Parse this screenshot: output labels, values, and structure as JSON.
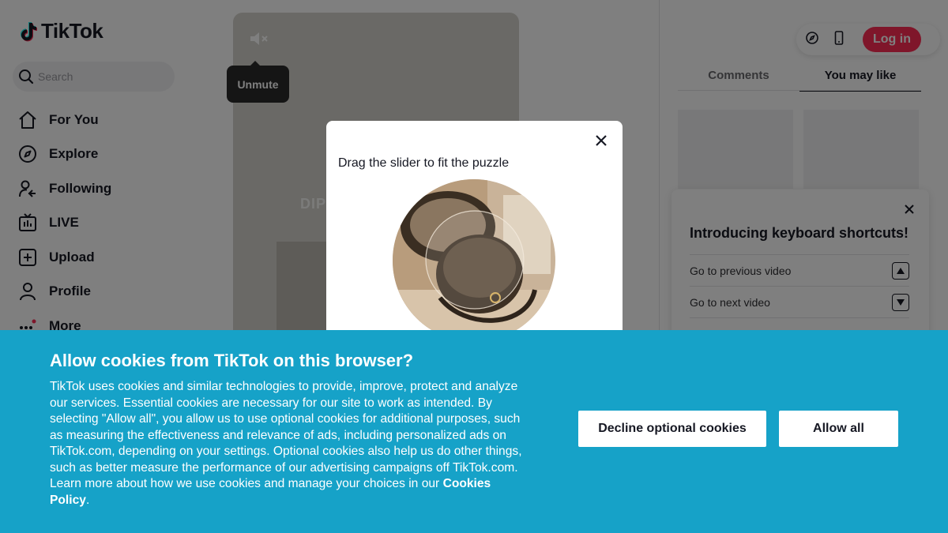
{
  "app": {
    "logo_text": "TikTok",
    "brand_color": "#fe2c55"
  },
  "search": {
    "placeholder": "Search"
  },
  "sidebar": {
    "items": [
      {
        "label": "For You",
        "icon": "home-icon"
      },
      {
        "label": "Explore",
        "icon": "compass-icon"
      },
      {
        "label": "Following",
        "icon": "following-icon"
      },
      {
        "label": "LIVE",
        "icon": "live-icon"
      },
      {
        "label": "Upload",
        "icon": "upload-icon"
      },
      {
        "label": "Profile",
        "icon": "profile-icon"
      },
      {
        "label": "More",
        "icon": "more-icon"
      }
    ]
  },
  "video": {
    "tooltip": "Unmute",
    "overlay_text": "DIP"
  },
  "header": {
    "login_label": "Log in"
  },
  "right_panel": {
    "tabs": [
      {
        "label": "Comments",
        "active": false
      },
      {
        "label": "You may like",
        "active": true
      }
    ]
  },
  "shortcuts": {
    "title": "Introducing keyboard shortcuts!",
    "rows": [
      {
        "label": "Go to previous video",
        "key": "up-arrow-key-icon"
      },
      {
        "label": "Go to next video",
        "key": "down-arrow-key-icon"
      }
    ]
  },
  "captcha": {
    "title": "Drag the slider to fit the puzzle"
  },
  "cookie_banner": {
    "title": "Allow cookies from TikTok on this browser?",
    "body": "TikTok uses cookies and similar technologies to provide, improve, protect and analyze our services. Essential cookies are necessary for our site to work as intended. By selecting \"Allow all\", you allow us to use optional cookies for additional purposes, such as measuring the effectiveness and relevance of ads, including personalized ads on TikTok.com, depending on your settings. Optional cookies also help us do other things, such as better measure the performance of our advertising campaigns off TikTok.com. Learn more about how we use cookies and manage your choices in our ",
    "link_label": "Cookies Policy",
    "after_link": ".",
    "decline_label": "Decline optional cookies",
    "allow_label": "Allow all",
    "background": "#16a2c8"
  }
}
